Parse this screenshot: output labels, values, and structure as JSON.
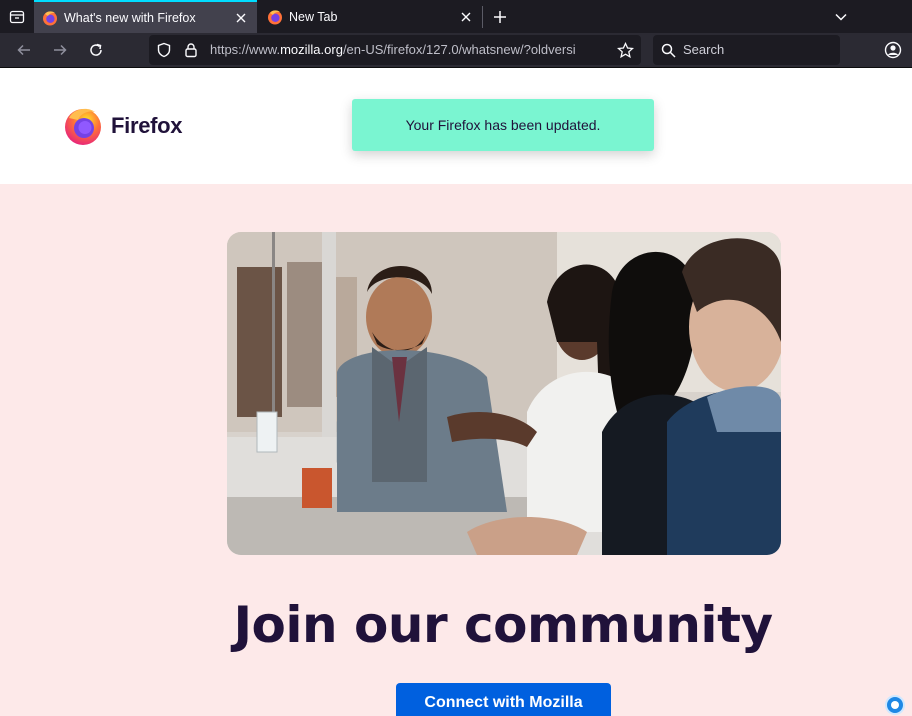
{
  "browser": {
    "tabs": [
      {
        "title": "What's new with Firefox",
        "active": true
      },
      {
        "title": "New Tab",
        "active": false
      }
    ],
    "url": {
      "prefix": "https://www.",
      "host": "mozilla.org",
      "path": "/en-US/firefox/127.0/whatsnew/?oldversi"
    },
    "search_placeholder": "Search"
  },
  "page": {
    "logo_text": "Firefox",
    "notice": "Your Firefox has been updated.",
    "headline": "Join our community",
    "cta_label": "Connect with Mozilla"
  },
  "colors": {
    "accent": "#0060df",
    "notice_bg": "#7af5d1",
    "page_bg": "#fde9e9",
    "heading": "#20123a",
    "tab_highlight": "#00ddff"
  }
}
